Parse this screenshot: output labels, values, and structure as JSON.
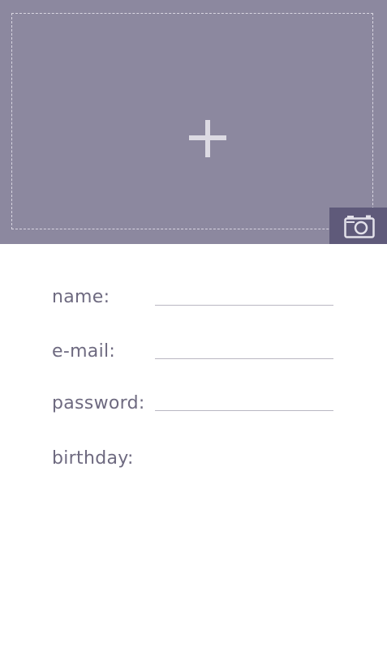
{
  "photo": {
    "add_icon": "plus-icon",
    "camera_icon": "camera-icon",
    "background_color": "#8c889f",
    "camera_button_color": "#5f5a7a"
  },
  "form": {
    "name": {
      "label": "name:",
      "value": "",
      "placeholder": ""
    },
    "email": {
      "label": "e-mail:",
      "value": "",
      "placeholder": ""
    },
    "password": {
      "label": "password:",
      "value": "",
      "placeholder": ""
    },
    "birthday": {
      "label": "birthday:"
    }
  }
}
